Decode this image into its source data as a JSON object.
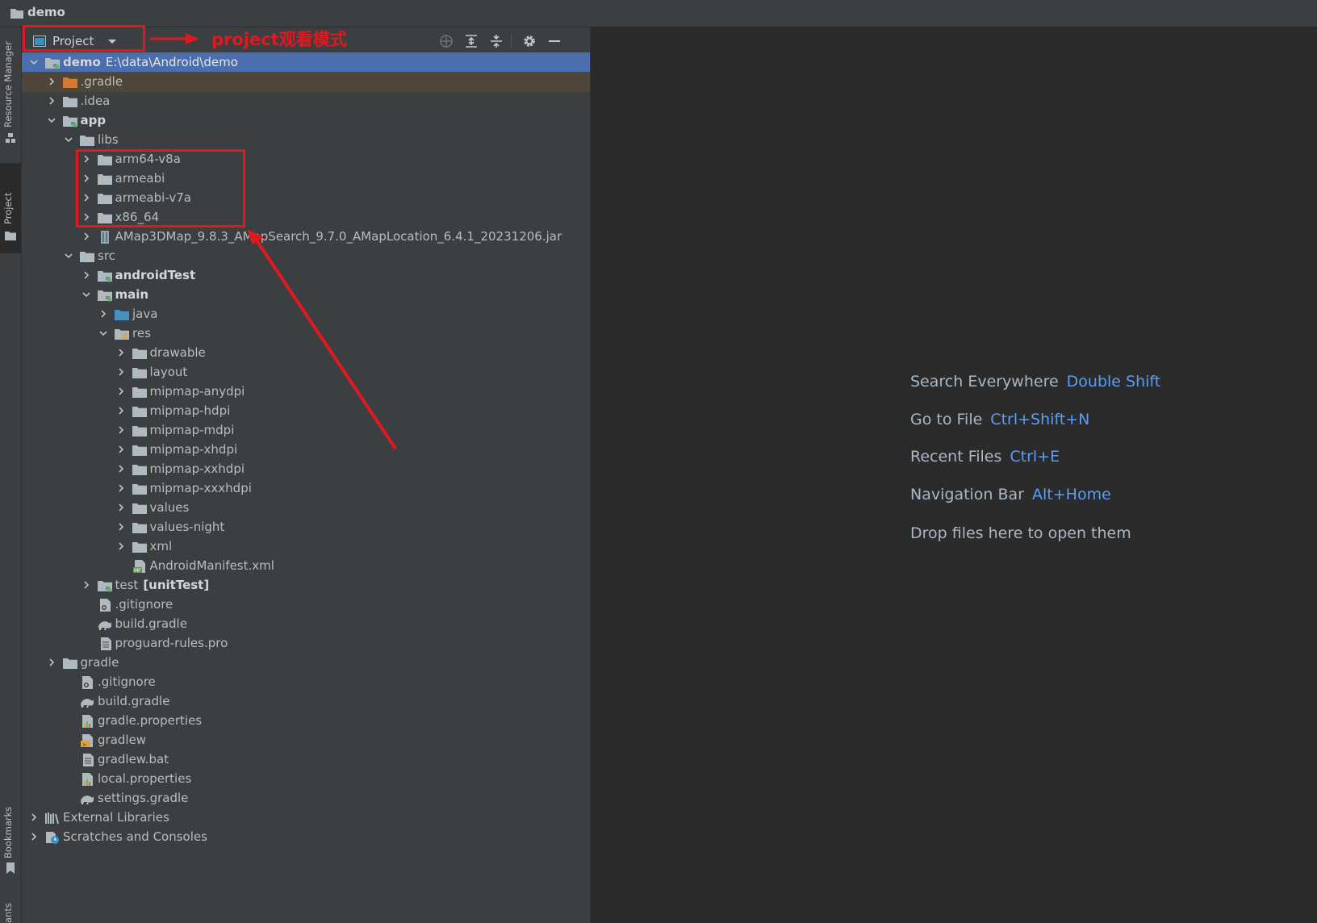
{
  "window": {
    "title": "demo"
  },
  "left_strip": {
    "resource_manager": "Resource Manager",
    "project": "Project",
    "bookmarks": "Bookmarks",
    "cut_label": "ants"
  },
  "panel": {
    "view_mode": "Project"
  },
  "annotation": {
    "callout": "project观看模式"
  },
  "tree": [
    {
      "label": "demo",
      "path": "E:\\data\\Android\\demo",
      "depth": 0,
      "expanded": true,
      "icon": "module-folder-icon",
      "bold": true,
      "selected": true
    },
    {
      "label": ".gradle",
      "depth": 1,
      "expanded": false,
      "icon": "excluded-folder-icon",
      "excluded": true
    },
    {
      "label": ".idea",
      "depth": 1,
      "expanded": false,
      "icon": "folder-icon"
    },
    {
      "label": "app",
      "depth": 1,
      "expanded": true,
      "icon": "module-folder-icon",
      "bold": true
    },
    {
      "label": "libs",
      "depth": 2,
      "expanded": true,
      "icon": "folder-icon"
    },
    {
      "label": "arm64-v8a",
      "depth": 3,
      "expanded": false,
      "icon": "folder-icon"
    },
    {
      "label": "armeabi",
      "depth": 3,
      "expanded": false,
      "icon": "folder-icon"
    },
    {
      "label": "armeabi-v7a",
      "depth": 3,
      "expanded": false,
      "icon": "folder-icon"
    },
    {
      "label": "x86_64",
      "depth": 3,
      "expanded": false,
      "icon": "folder-icon"
    },
    {
      "label": "AMap3DMap_9.8.3_AMapSearch_9.7.0_AMapLocation_6.4.1_20231206.jar",
      "depth": 3,
      "expanded": false,
      "icon": "jar-icon"
    },
    {
      "label": "src",
      "depth": 2,
      "expanded": true,
      "icon": "folder-icon"
    },
    {
      "label": "androidTest",
      "depth": 3,
      "expanded": false,
      "icon": "module-folder-icon",
      "bold": true
    },
    {
      "label": "main",
      "depth": 3,
      "expanded": true,
      "icon": "module-folder-icon",
      "bold": true
    },
    {
      "label": "java",
      "depth": 4,
      "expanded": false,
      "icon": "source-folder-icon"
    },
    {
      "label": "res",
      "depth": 4,
      "expanded": true,
      "icon": "resource-folder-icon"
    },
    {
      "label": "drawable",
      "depth": 5,
      "expanded": false,
      "icon": "folder-icon"
    },
    {
      "label": "layout",
      "depth": 5,
      "expanded": false,
      "icon": "folder-icon"
    },
    {
      "label": "mipmap-anydpi",
      "depth": 5,
      "expanded": false,
      "icon": "folder-icon"
    },
    {
      "label": "mipmap-hdpi",
      "depth": 5,
      "expanded": false,
      "icon": "folder-icon"
    },
    {
      "label": "mipmap-mdpi",
      "depth": 5,
      "expanded": false,
      "icon": "folder-icon"
    },
    {
      "label": "mipmap-xhdpi",
      "depth": 5,
      "expanded": false,
      "icon": "folder-icon"
    },
    {
      "label": "mipmap-xxhdpi",
      "depth": 5,
      "expanded": false,
      "icon": "folder-icon"
    },
    {
      "label": "mipmap-xxxhdpi",
      "depth": 5,
      "expanded": false,
      "icon": "folder-icon"
    },
    {
      "label": "values",
      "depth": 5,
      "expanded": false,
      "icon": "folder-icon"
    },
    {
      "label": "values-night",
      "depth": 5,
      "expanded": false,
      "icon": "folder-icon"
    },
    {
      "label": "xml",
      "depth": 5,
      "expanded": false,
      "icon": "folder-icon"
    },
    {
      "label": "AndroidManifest.xml",
      "depth": 5,
      "icon": "manifest-file-icon"
    },
    {
      "label": "test",
      "suffix": "[unitTest]",
      "depth": 3,
      "expanded": false,
      "icon": "module-folder-icon"
    },
    {
      "label": ".gitignore",
      "depth": 3,
      "icon": "gitignore-file-icon"
    },
    {
      "label": "build.gradle",
      "depth": 3,
      "icon": "gradle-file-icon"
    },
    {
      "label": "proguard-rules.pro",
      "depth": 3,
      "icon": "text-file-icon"
    },
    {
      "label": "gradle",
      "depth": 1,
      "expanded": false,
      "icon": "folder-icon"
    },
    {
      "label": ".gitignore",
      "depth": 2,
      "icon": "gitignore-file-icon"
    },
    {
      "label": "build.gradle",
      "depth": 2,
      "icon": "gradle-file-icon"
    },
    {
      "label": "gradle.properties",
      "depth": 2,
      "icon": "properties-file-icon"
    },
    {
      "label": "gradlew",
      "depth": 2,
      "icon": "shell-script-icon"
    },
    {
      "label": "gradlew.bat",
      "depth": 2,
      "icon": "text-file-icon"
    },
    {
      "label": "local.properties",
      "depth": 2,
      "icon": "properties-file-icon"
    },
    {
      "label": "settings.gradle",
      "depth": 2,
      "icon": "gradle-file-icon"
    },
    {
      "label": "External Libraries",
      "depth": 0,
      "expanded": false,
      "icon": "libraries-icon"
    },
    {
      "label": "Scratches and Consoles",
      "depth": 0,
      "expanded": false,
      "icon": "scratches-icon"
    }
  ],
  "editor_hints": [
    {
      "text": "Search Everywhere",
      "key": "Double Shift"
    },
    {
      "text": "Go to File",
      "key": "Ctrl+Shift+N"
    },
    {
      "text": "Recent Files",
      "key": "Ctrl+E"
    },
    {
      "text": "Navigation Bar",
      "key": "Alt+Home"
    },
    {
      "text": "Drop files here to open them",
      "key": ""
    }
  ],
  "colors": {
    "accent": "#589df6",
    "selection": "#4b6eaf",
    "annotation": "#e0191f",
    "folder": "#aeb9c0"
  }
}
